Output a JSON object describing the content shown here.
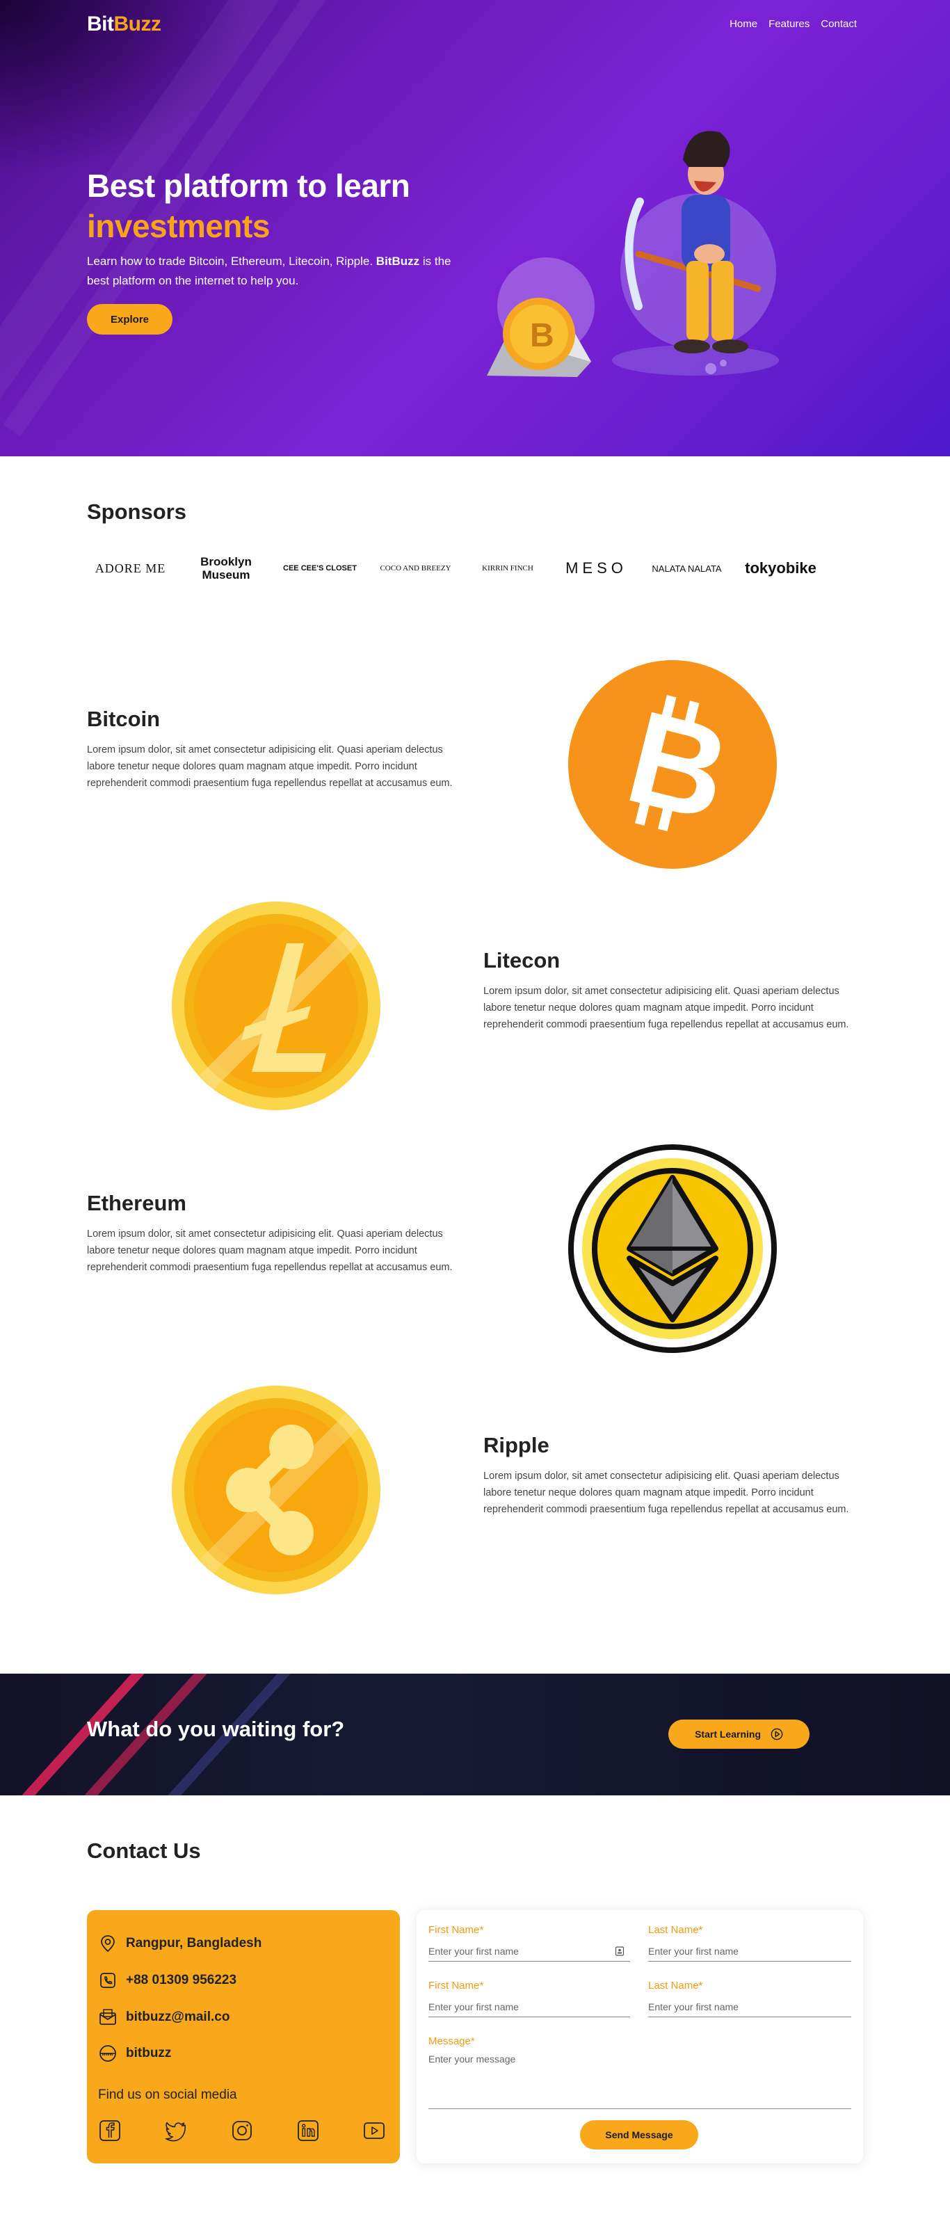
{
  "header": {
    "logo_part1": "Bit",
    "logo_part2": "Buzz",
    "nav": [
      "Home",
      "Features",
      "Contact"
    ]
  },
  "hero": {
    "title_line1": "Best platform to learn",
    "title_line2": "investments",
    "subtitle_pre": "Learn how to trade Bitcoin, Ethereum, Litecoin, Ripple. ",
    "subtitle_brand": "BitBuzz",
    "subtitle_post": " is the best platform on the internet to help you.",
    "explore_label": "Explore"
  },
  "sponsors": {
    "title": "Sponsors",
    "logos": [
      "ADORE ME",
      "Brooklyn Museum",
      "CEE CEE'S CLOSET",
      "COCO AND BREEZY",
      "KIRRIN FINCH",
      "MESO",
      "NALATA NALATA",
      "tokyobike"
    ]
  },
  "features": [
    {
      "title": "Bitcoin",
      "text": "Lorem ipsum dolor, sit amet consectetur adipisicing elit. Quasi aperiam delectus labore tenetur neque dolores quam magnam atque impedit. Porro incidunt reprehenderit commodi praesentium fuga repellendus repellat at accusamus eum.",
      "icon": "bitcoin-icon"
    },
    {
      "title": "Litecon",
      "text": "Lorem ipsum dolor, sit amet consectetur adipisicing elit. Quasi aperiam delectus labore tenetur neque dolores quam magnam atque impedit. Porro incidunt reprehenderit commodi praesentium fuga repellendus repellat at accusamus eum.",
      "icon": "litecoin-icon"
    },
    {
      "title": "Ethereum",
      "text": "Lorem ipsum dolor, sit amet consectetur adipisicing elit. Quasi aperiam delectus labore tenetur neque dolores quam magnam atque impedit. Porro incidunt reprehenderit commodi praesentium fuga repellendus repellat at accusamus eum.",
      "icon": "ethereum-icon"
    },
    {
      "title": "Ripple",
      "text": "Lorem ipsum dolor, sit amet consectetur adipisicing elit. Quasi aperiam delectus labore tenetur neque dolores quam magnam atque impedit. Porro incidunt reprehenderit commodi praesentium fuga repellendus repellat at accusamus eum.",
      "icon": "ripple-icon"
    }
  ],
  "cta": {
    "title": "What do you waiting for?",
    "button_label": "Start Learning"
  },
  "contact": {
    "title": "Contact Us",
    "address": "Rangpur, Bangladesh",
    "phone": "+88 01309 956223",
    "email": "bitbuzz@mail.co",
    "website": "bitbuzz",
    "social_title": "Find us on social media",
    "social_icons": [
      "facebook-icon",
      "twitter-icon",
      "instagram-icon",
      "linkedin-icon",
      "youtube-icon"
    ],
    "form": {
      "first_name_label": "First Name*",
      "first_name_placeholder": "Enter your first name",
      "last_name_label": "Last Name*",
      "last_name_placeholder": "Enter your first name",
      "first_name2_label": "First Name*",
      "first_name2_placeholder": "Enter your first name",
      "last_name2_label": "Last Name*",
      "last_name2_placeholder": "Enter your first name",
      "message_label": "Message*",
      "message_placeholder": "Enter your message",
      "send_label": "Send Message"
    }
  },
  "colors": {
    "accent": "#f9a81b",
    "hero_purple": "#7c22d6",
    "cta_dark": "#131228"
  }
}
